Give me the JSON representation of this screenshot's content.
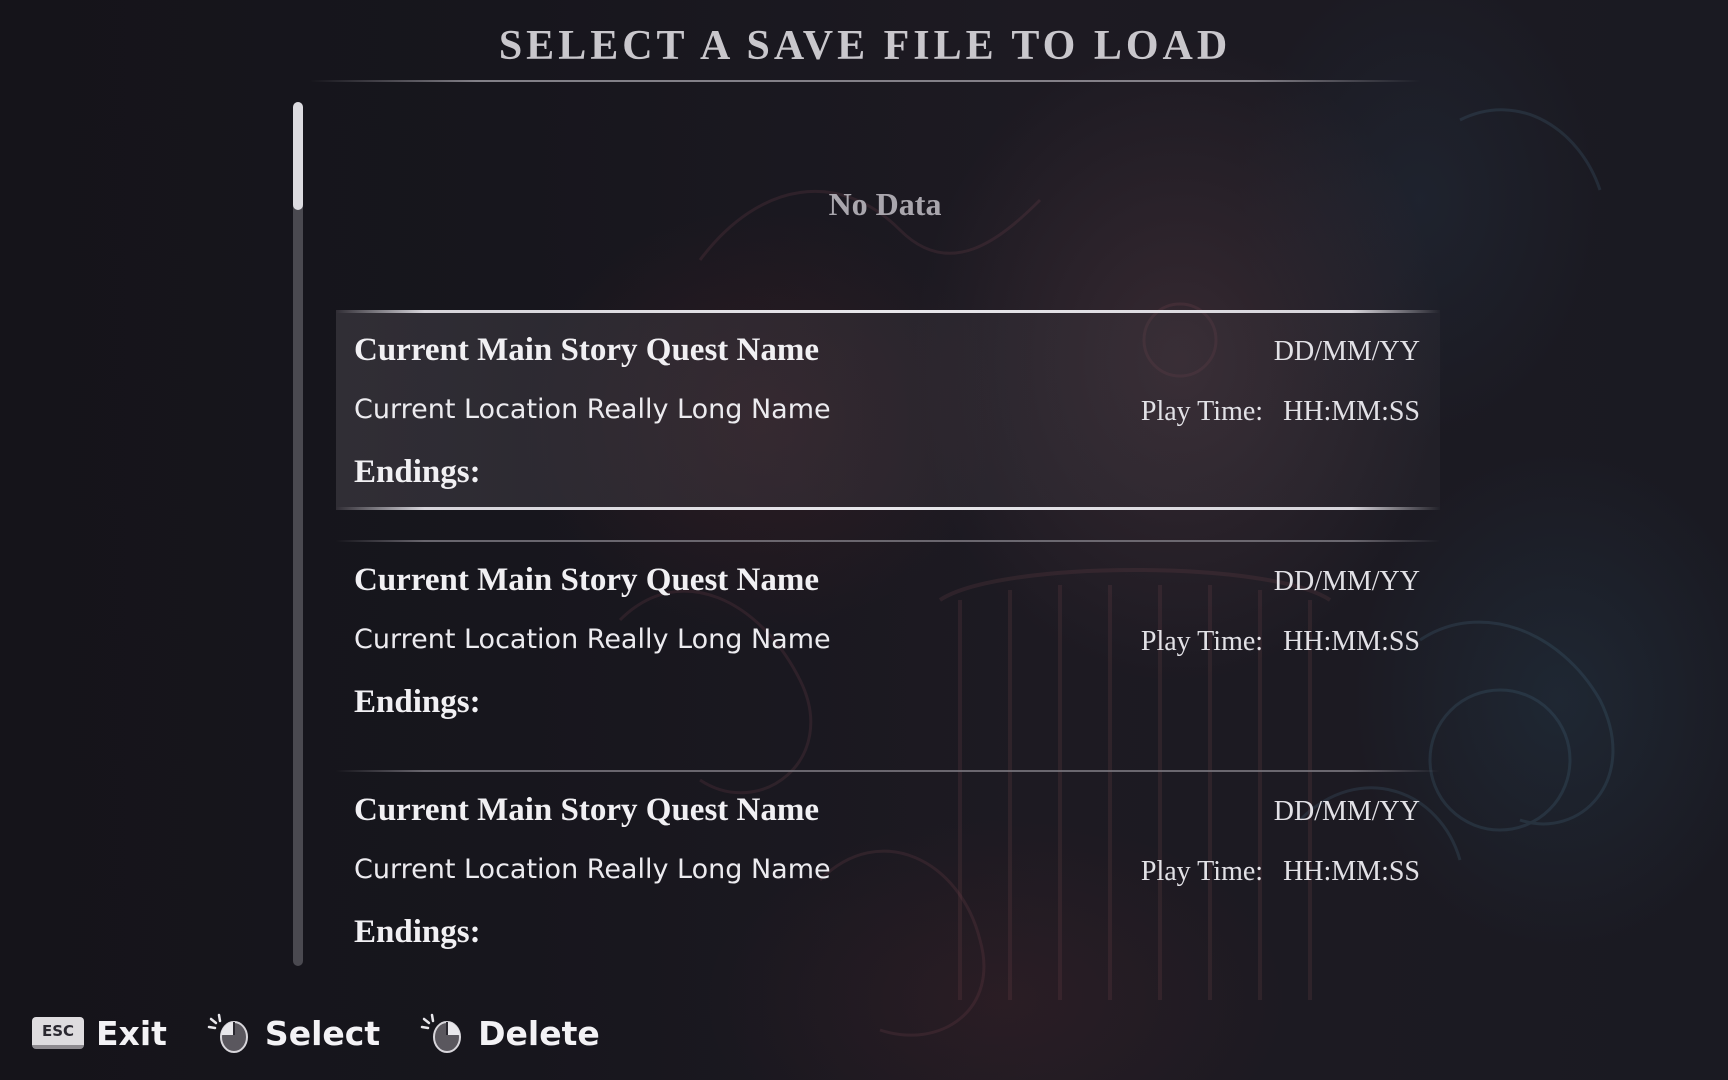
{
  "header": {
    "title": "SELECT A SAVE FILE TO LOAD"
  },
  "empty_slot": {
    "text": "No Data"
  },
  "slots": [
    {
      "quest": "Current Main Story Quest Name",
      "date": "DD/MM/YY",
      "location": "Current Location Really Long Name",
      "play_time_label": "Play Time:",
      "play_time": "HH:MM:SS",
      "endings_label": "Endings:",
      "selected": true
    },
    {
      "quest": "Current Main Story Quest Name",
      "date": "DD/MM/YY",
      "location": "Current Location Really Long Name",
      "play_time_label": "Play Time:",
      "play_time": "HH:MM:SS",
      "endings_label": "Endings:",
      "selected": false
    },
    {
      "quest": "Current Main Story Quest Name",
      "date": "DD/MM/YY",
      "location": "Current Location Really Long Name",
      "play_time_label": "Play Time:",
      "play_time": "HH:MM:SS",
      "endings_label": "Endings:",
      "selected": false
    }
  ],
  "controls": {
    "exit": {
      "key": "ESC",
      "label": "Exit",
      "icon": "esc-key-icon"
    },
    "select": {
      "label": "Select",
      "icon": "mouse-left-click-icon"
    },
    "delete": {
      "label": "Delete",
      "icon": "mouse-right-click-icon"
    }
  },
  "scrollbar": {
    "position_fraction": 0.0,
    "visible_fraction": 0.125
  },
  "colors": {
    "background": "#16151c",
    "text": "#f1f0f3",
    "muted": "#a9a6ad",
    "selected_rule": "#e8e7eb"
  }
}
